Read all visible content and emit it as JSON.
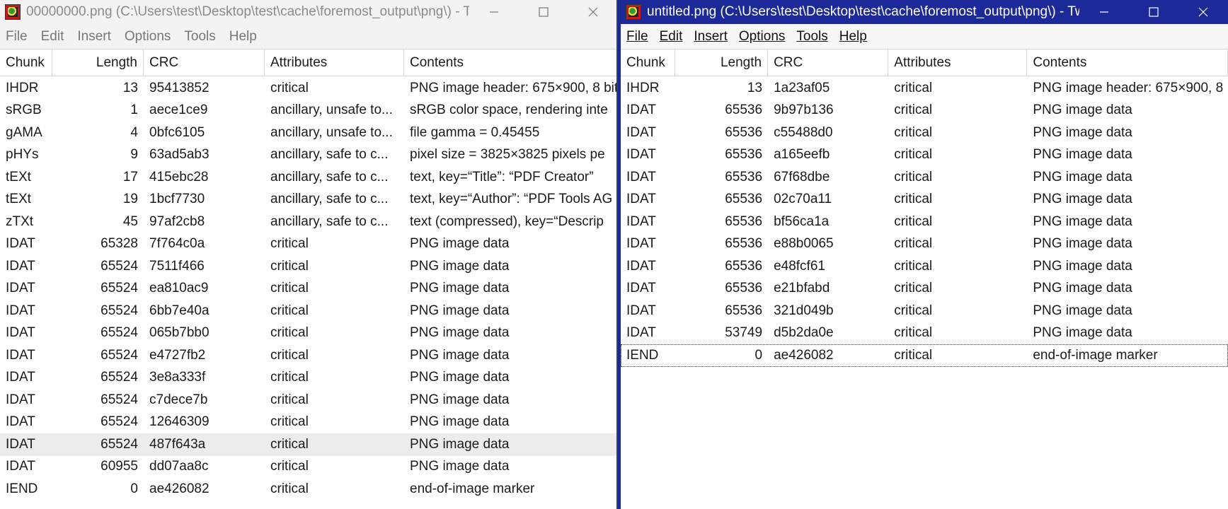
{
  "left_window": {
    "title": "00000000.png (C:\\Users\\test\\Desktop\\test\\cache\\foremost_output\\png\\) - T...",
    "menu": [
      "File",
      "Edit",
      "Insert",
      "Options",
      "Tools",
      "Help"
    ],
    "columns": [
      "Chunk",
      "Length",
      "CRC",
      "Attributes",
      "Contents"
    ],
    "rows": [
      {
        "chunk": "IHDR",
        "length": "13",
        "crc": "95413852",
        "attributes": "critical",
        "contents": "PNG image header: 675×900, 8 bit"
      },
      {
        "chunk": "sRGB",
        "length": "1",
        "crc": "aece1ce9",
        "attributes": "ancillary, unsafe to...",
        "contents": "sRGB color space, rendering inte"
      },
      {
        "chunk": "gAMA",
        "length": "4",
        "crc": "0bfc6105",
        "attributes": "ancillary, unsafe to...",
        "contents": "file gamma = 0.45455"
      },
      {
        "chunk": "pHYs",
        "length": "9",
        "crc": "63ad5ab3",
        "attributes": "ancillary, safe to c...",
        "contents": "pixel size = 3825×3825 pixels pe"
      },
      {
        "chunk": "tEXt",
        "length": "17",
        "crc": "415ebc28",
        "attributes": "ancillary, safe to c...",
        "contents": "text, key=“Title”: “PDF Creator”"
      },
      {
        "chunk": "tEXt",
        "length": "19",
        "crc": "1bcf7730",
        "attributes": "ancillary, safe to c...",
        "contents": "text, key=“Author”: “PDF Tools AG"
      },
      {
        "chunk": "zTXt",
        "length": "45",
        "crc": "97af2cb8",
        "attributes": "ancillary, safe to c...",
        "contents": "text (compressed), key=“Descrip"
      },
      {
        "chunk": "IDAT",
        "length": "65328",
        "crc": "7f764c0a",
        "attributes": "critical",
        "contents": "PNG image data"
      },
      {
        "chunk": "IDAT",
        "length": "65524",
        "crc": "7511f466",
        "attributes": "critical",
        "contents": "PNG image data"
      },
      {
        "chunk": "IDAT",
        "length": "65524",
        "crc": "ea810ac9",
        "attributes": "critical",
        "contents": "PNG image data"
      },
      {
        "chunk": "IDAT",
        "length": "65524",
        "crc": "6bb7e40a",
        "attributes": "critical",
        "contents": "PNG image data"
      },
      {
        "chunk": "IDAT",
        "length": "65524",
        "crc": "065b7bb0",
        "attributes": "critical",
        "contents": "PNG image data"
      },
      {
        "chunk": "IDAT",
        "length": "65524",
        "crc": "e4727fb2",
        "attributes": "critical",
        "contents": "PNG image data"
      },
      {
        "chunk": "IDAT",
        "length": "65524",
        "crc": "3e8a333f",
        "attributes": "critical",
        "contents": "PNG image data"
      },
      {
        "chunk": "IDAT",
        "length": "65524",
        "crc": "c7dece7b",
        "attributes": "critical",
        "contents": "PNG image data"
      },
      {
        "chunk": "IDAT",
        "length": "65524",
        "crc": "12646309",
        "attributes": "critical",
        "contents": "PNG image data"
      },
      {
        "chunk": "IDAT",
        "length": "65524",
        "crc": "487f643a",
        "attributes": "critical",
        "contents": "PNG image data",
        "selected": true
      },
      {
        "chunk": "IDAT",
        "length": "60955",
        "crc": "dd07aa8c",
        "attributes": "critical",
        "contents": "PNG image data"
      },
      {
        "chunk": "IEND",
        "length": "0",
        "crc": "ae426082",
        "attributes": "critical",
        "contents": "end-of-image marker"
      }
    ]
  },
  "right_window": {
    "title": "untitled.png (C:\\Users\\test\\Desktop\\test\\cache\\foremost_output\\png\\) - Twe...",
    "menu": [
      "File",
      "Edit",
      "Insert",
      "Options",
      "Tools",
      "Help"
    ],
    "columns": [
      "Chunk",
      "Length",
      "CRC",
      "Attributes",
      "Contents"
    ],
    "rows": [
      {
        "chunk": "IHDR",
        "length": "13",
        "crc": "1a23af05",
        "attributes": "critical",
        "contents": "PNG image header: 675×900, 8"
      },
      {
        "chunk": "IDAT",
        "length": "65536",
        "crc": "9b97b136",
        "attributes": "critical",
        "contents": "PNG image data"
      },
      {
        "chunk": "IDAT",
        "length": "65536",
        "crc": "c55488d0",
        "attributes": "critical",
        "contents": "PNG image data"
      },
      {
        "chunk": "IDAT",
        "length": "65536",
        "crc": "a165eefb",
        "attributes": "critical",
        "contents": "PNG image data"
      },
      {
        "chunk": "IDAT",
        "length": "65536",
        "crc": "67f68dbe",
        "attributes": "critical",
        "contents": "PNG image data"
      },
      {
        "chunk": "IDAT",
        "length": "65536",
        "crc": "02c70a11",
        "attributes": "critical",
        "contents": "PNG image data"
      },
      {
        "chunk": "IDAT",
        "length": "65536",
        "crc": "bf56ca1a",
        "attributes": "critical",
        "contents": "PNG image data"
      },
      {
        "chunk": "IDAT",
        "length": "65536",
        "crc": "e88b0065",
        "attributes": "critical",
        "contents": "PNG image data"
      },
      {
        "chunk": "IDAT",
        "length": "65536",
        "crc": "e48fcf61",
        "attributes": "critical",
        "contents": "PNG image data"
      },
      {
        "chunk": "IDAT",
        "length": "65536",
        "crc": "e21bfabd",
        "attributes": "critical",
        "contents": "PNG image data"
      },
      {
        "chunk": "IDAT",
        "length": "65536",
        "crc": "321d049b",
        "attributes": "critical",
        "contents": "PNG image data"
      },
      {
        "chunk": "IDAT",
        "length": "53749",
        "crc": "d5b2da0e",
        "attributes": "critical",
        "contents": "PNG image data"
      },
      {
        "chunk": "IEND",
        "length": "0",
        "crc": "ae426082",
        "attributes": "critical",
        "contents": "end-of-image marker",
        "focused": true
      }
    ]
  }
}
